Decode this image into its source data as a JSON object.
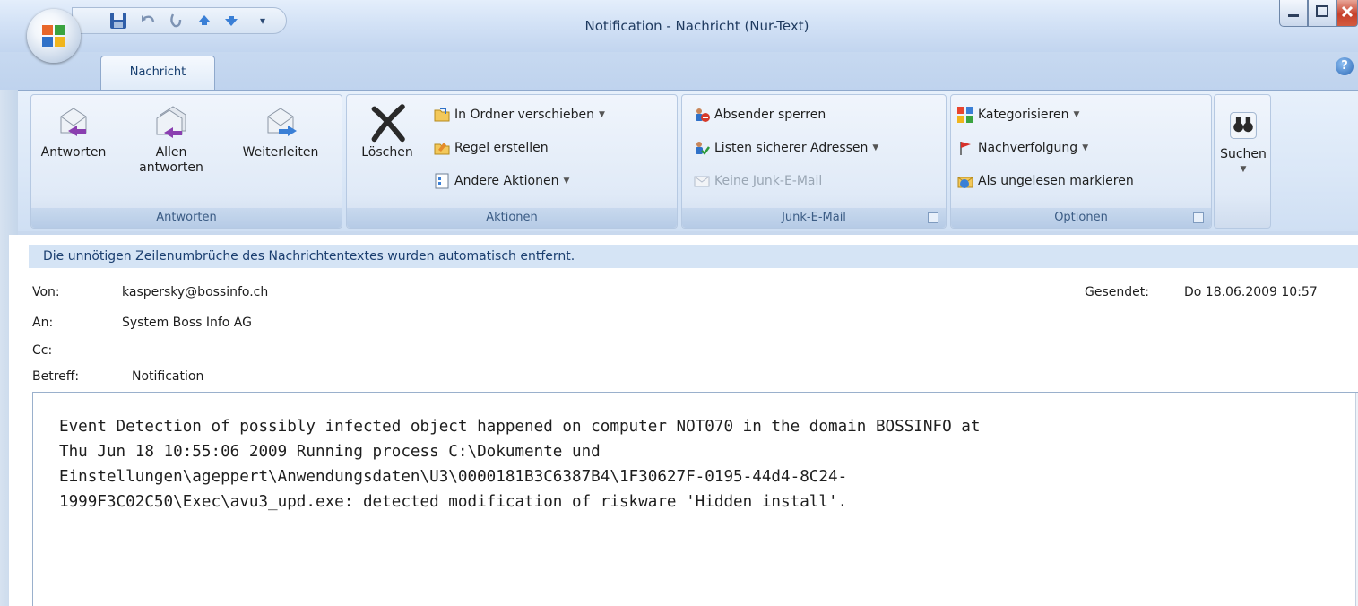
{
  "window": {
    "title": "Notification - Nachricht (Nur-Text)"
  },
  "tabs": [
    {
      "label": "Nachricht",
      "active": true
    }
  ],
  "ribbon": {
    "groups": {
      "antworten": {
        "label": "Antworten",
        "reply": "Antworten",
        "reply_all_line1": "Allen",
        "reply_all_line2": "antworten",
        "forward": "Weiterleiten"
      },
      "aktionen": {
        "label": "Aktionen",
        "delete": "Löschen",
        "move": "In Ordner verschieben",
        "rule": "Regel erstellen",
        "other": "Andere Aktionen"
      },
      "junk": {
        "label": "Junk-E-Mail",
        "block": "Absender sperren",
        "safe_lists": "Listen sicherer Adressen",
        "not_junk": "Keine Junk-E-Mail"
      },
      "optionen": {
        "label": "Optionen",
        "categorize": "Kategorisieren",
        "follow_up": "Nachverfolgung",
        "mark_unread": "Als ungelesen markieren"
      },
      "suchen": {
        "label": "Suchen"
      }
    }
  },
  "infobar": {
    "text": "Die unnötigen Zeilenumbrüche des Nachrichtentextes wurden automatisch entfernt."
  },
  "header": {
    "from_label": "Von:",
    "from_value": "kaspersky@bossinfo.ch",
    "to_label": "An:",
    "to_value": "System Boss Info AG",
    "cc_label": "Cc:",
    "cc_value": "",
    "subject_label": "Betreff:",
    "subject_value": "Notification",
    "sent_label": "Gesendet:",
    "sent_value": "Do 18.06.2009 10:57"
  },
  "body": {
    "lines": [
      "Event Detection of possibly infected object happened on computer NOT070 in the domain BOSSINFO at",
      "Thu Jun 18 10:55:06 2009 Running process C:\\Dokumente und",
      "Einstellungen\\ageppert\\Anwendungsdaten\\U3\\0000181B3C6387B4\\1F30627F-0195-44d4-8C24-",
      "1999F3C02C50\\Exec\\avu3_upd.exe: detected modification of riskware 'Hidden install'."
    ]
  },
  "icons": {
    "office_button": "office-logo-icon",
    "save": "save-icon",
    "undo": "undo-icon",
    "redo": "redo-icon",
    "prev": "up-arrow-icon",
    "next": "down-arrow-icon",
    "help": "help-icon"
  },
  "colors": {
    "accent": "#1b3f70",
    "ribbon_bg": "#dae7f7",
    "infobar_bg": "#d5e4f5",
    "close_button": "#c6402a"
  }
}
